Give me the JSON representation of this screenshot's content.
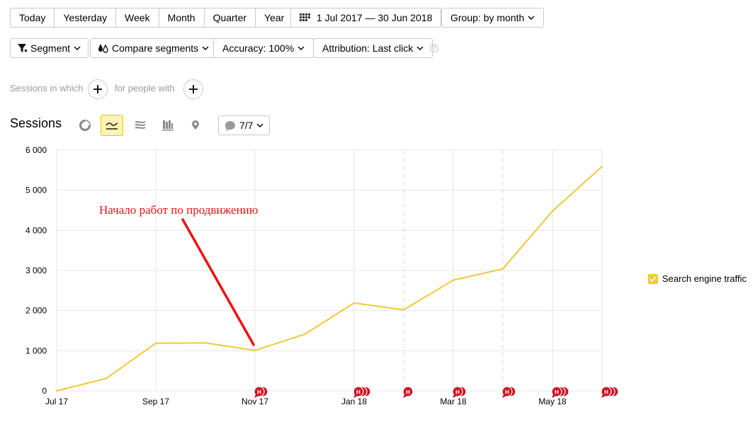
{
  "periods": [
    "Today",
    "Yesterday",
    "Week",
    "Month",
    "Quarter",
    "Year"
  ],
  "date_range": "1 Jul 2017 — 30 Jun 2018",
  "group": "Group: by month",
  "filters": {
    "segment": "Segment",
    "compare": "Compare segments",
    "accuracy": "Accuracy: 100%",
    "attribution": "Attribution: Last click",
    "help": "?"
  },
  "conditions": {
    "sessions_label": "Sessions in which",
    "people_label": "for people with"
  },
  "report": {
    "title": "Sessions",
    "series_counter": "7/7"
  },
  "annotation": "Начало работ по продвижению",
  "note_marker_letter": "Н",
  "colors": {
    "series": "#f0c93a",
    "arrow": "#ee1111",
    "annotation": "#ee1111",
    "marker": "#cc1122",
    "active": "#fff3b0"
  },
  "chart_data": {
    "type": "line",
    "x": [
      "Jul 17",
      "Aug 17",
      "Sep 17",
      "Oct 17",
      "Nov 17",
      "Dec 17",
      "Jan 18",
      "Feb 18",
      "Mar 18",
      "Apr 18",
      "May 18",
      "Jun 18"
    ],
    "x_tick_labels": [
      "Jul 17",
      "Sep 17",
      "Nov 17",
      "Jan 18",
      "Mar 18",
      "May 18"
    ],
    "series": [
      {
        "name": "Search engine traffic",
        "values": [
          0,
          310,
          1190,
          1195,
          1010,
          1410,
          2190,
          2020,
          2760,
          3040,
          4480,
          5590
        ]
      }
    ],
    "y_ticks": [
      "0",
      "1 000",
      "2 000",
      "3 000",
      "4 000",
      "5 000",
      "6 000"
    ],
    "ylim": [
      0,
      6000
    ],
    "grid": true,
    "legend_position": "right",
    "notes": [
      {
        "month": "Nov 17",
        "count": 2
      },
      {
        "month": "Jan 18",
        "count": 3
      },
      {
        "month": "Feb 18",
        "count": 1
      },
      {
        "month": "Mar 18",
        "count": 2
      },
      {
        "month": "Apr 18",
        "count": 2
      },
      {
        "month": "May 18",
        "count": 3
      },
      {
        "month": "Jun 18",
        "count": 3
      }
    ],
    "annotation_month": "Nov 17",
    "dashed_months": [
      "Feb 18",
      "Apr 18"
    ]
  }
}
